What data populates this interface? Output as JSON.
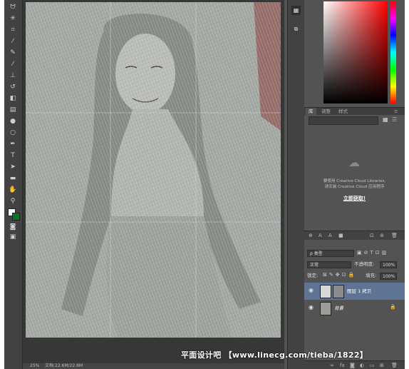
{
  "toolbar": {
    "tools": [
      "lasso-icon",
      "magic-wand-icon",
      "crop-icon",
      "eyedropper-icon",
      "healing-brush-icon",
      "brush-icon",
      "clone-stamp-icon",
      "history-brush-icon",
      "eraser-icon",
      "gradient-icon",
      "blur-icon",
      "dodge-icon",
      "pen-icon",
      "type-icon",
      "path-select-icon",
      "shape-icon",
      "hand-icon",
      "zoom-icon",
      "quick-mask-icon",
      "screen-mode-icon"
    ],
    "type_tool_glyph": "T"
  },
  "status": {
    "zoom": "25%",
    "doc_info": "文档:22.6M/22.6M"
  },
  "panels": {
    "tabs_library": [
      "库",
      "调整",
      "样式"
    ],
    "library": {
      "message_line1": "要使用 Creative Cloud Libraries,",
      "message_line2": "请安装 Creative Cloud 应用程序",
      "link": "立即获取!"
    },
    "layers": {
      "tabs": [
        "图层",
        "通道",
        "路径"
      ],
      "filter_type": "ρ 类型",
      "blend_mode": "正常",
      "opacity_label": "不透明度:",
      "opacity_value": "100%",
      "lock_label": "锁定:",
      "fill_label": "填充:",
      "fill_value": "100%",
      "items": [
        {
          "name": "图层 1 拷贝",
          "selected": true
        },
        {
          "name": "背景",
          "selected": false
        }
      ]
    }
  },
  "watermark": "平面设计吧 【www.linecg.com/tieba/1822】"
}
